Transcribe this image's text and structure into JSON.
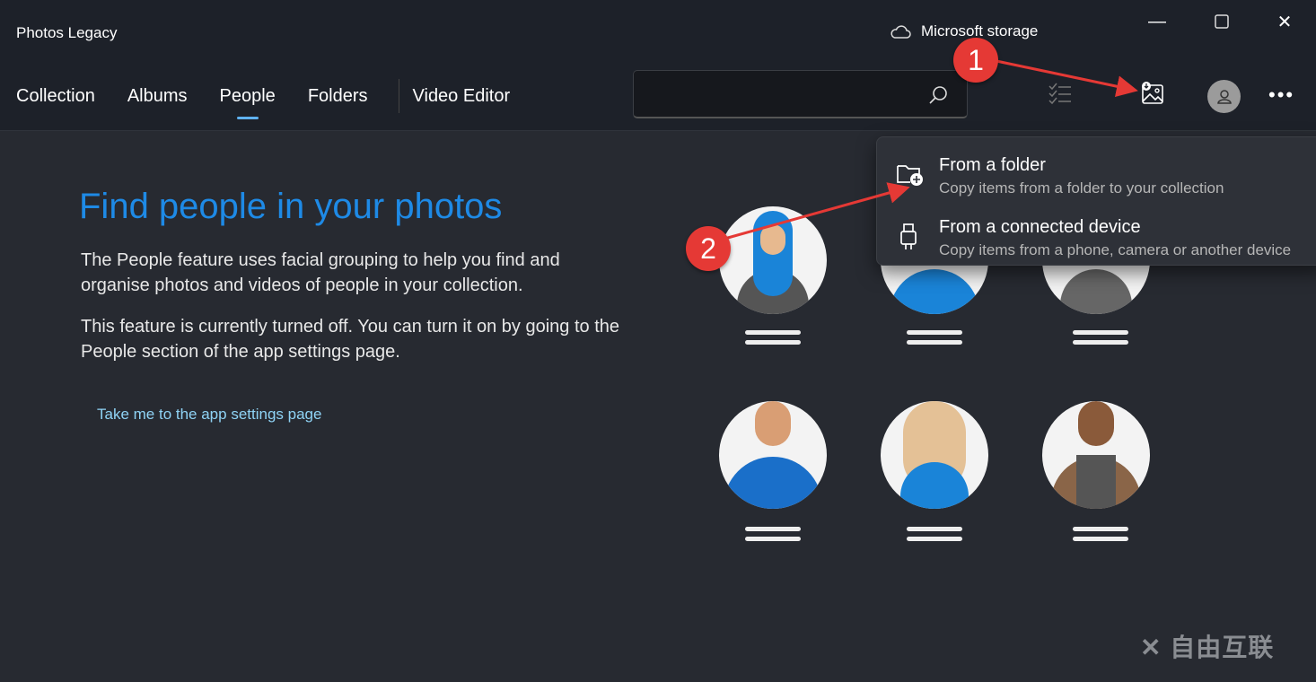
{
  "window": {
    "title": "Photos Legacy",
    "storage": "Microsoft storage"
  },
  "nav": {
    "items": [
      "Collection",
      "Albums",
      "People",
      "Folders",
      "Video Editor"
    ],
    "active": "People"
  },
  "search": {
    "placeholder": "",
    "value": ""
  },
  "main": {
    "heading": "Find people in your photos",
    "para1": "The People feature uses facial grouping to help you find and organise photos and videos of people in your collection.",
    "para2": "This feature is currently turned off. You can turn it on by going to the People section of the app settings page.",
    "link": "Take me to the app settings page"
  },
  "import_menu": {
    "items": [
      {
        "title": "From a folder",
        "subtitle": "Copy items from a folder to your collection",
        "icon": "folder-add-icon"
      },
      {
        "title": "From a connected device",
        "subtitle": "Copy items from a phone, camera or another device",
        "icon": "usb-plug-icon"
      }
    ]
  },
  "annotations": {
    "step1": "1",
    "step2": "2"
  },
  "watermark": "自由互联",
  "colors": {
    "accent": "#1e8ae6",
    "link": "#8fd3f5",
    "badge": "#e53935"
  }
}
